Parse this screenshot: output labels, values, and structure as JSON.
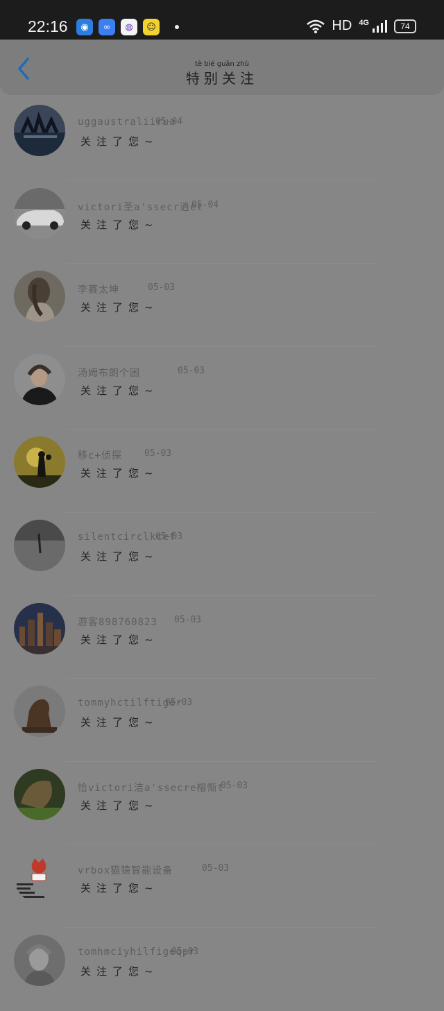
{
  "status_bar": {
    "time": "22:16",
    "network_label": "HD",
    "signal_label": "4G",
    "battery": "74"
  },
  "header": {
    "title": "特别关注",
    "title_pinyin": "tè bié guān zhù"
  },
  "list": {
    "items": [
      {
        "name": "uggaustraliirua",
        "date": "05-04",
        "message": "关注了您~"
      },
      {
        "name": "victori圣a'ssecr逍et",
        "date": "05-04",
        "message": "关注了您~"
      },
      {
        "name": "李赛太坤",
        "date": "05-03",
        "message": "关注了您~"
      },
      {
        "name": "汤姆布朗个困",
        "date": "05-03",
        "message": "关注了您~"
      },
      {
        "name": "移c+侦探",
        "date": "05-03",
        "message": "关注了您~"
      },
      {
        "name": "silentcirclkcef",
        "date": "05-03",
        "message": "关注了您~"
      },
      {
        "name": "游客898760823",
        "date": "05-03",
        "message": "关注了您~"
      },
      {
        "name": "tommyhctilftiger",
        "date": "05-03",
        "message": "关注了您~"
      },
      {
        "name": "恰victori洁a'ssecre榕惭t",
        "date": "05-03",
        "message": "关注了您~"
      },
      {
        "name": "vrbox猫猿智能设备",
        "date": "05-03",
        "message": "关注了您~"
      },
      {
        "name": "tomhmciyhilfigeqpr",
        "date": "05-03",
        "message": "关注了您~"
      }
    ]
  },
  "colors": {
    "accent": "#1e6bb8",
    "dimmed_background": "#868686",
    "status_bar": "#1c1c1c"
  }
}
